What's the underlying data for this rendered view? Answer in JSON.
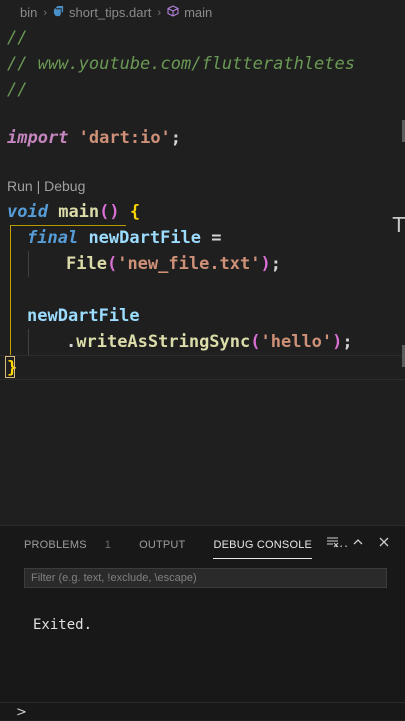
{
  "breadcrumb": {
    "folder": "bin",
    "file": "short_tips.dart",
    "symbol": "main"
  },
  "code": {
    "comment1": "//",
    "comment2": "// www.youtube.com/flutterathletes",
    "comment3": "//",
    "import_kw": "import",
    "import_str": "'dart:io'",
    "import_end": ";",
    "codelens": "Run | Debug",
    "main_type": "void",
    "main_name": "main",
    "main_parens": "()",
    "main_brace": "{",
    "final_kw": "final",
    "var_name": "newDartFile",
    "assign": "=",
    "ctor": "File",
    "ctor_open": "(",
    "ctor_arg": "'new_file.txt'",
    "ctor_close": ")",
    "ctor_end": ";",
    "var_ref": "newDartFile",
    "method_dot": ".",
    "method": "writeAsStringSync",
    "method_open": "(",
    "method_arg": "'hello'",
    "method_close": ")",
    "method_end": ";",
    "close_brace": "}"
  },
  "panel": {
    "tabs": [
      {
        "label": "PROBLEMS",
        "count": "1"
      },
      {
        "label": "OUTPUT"
      },
      {
        "label": "DEBUG CONSOLE"
      }
    ],
    "more_label": "···",
    "filter_placeholder": "Filter (e.g. text, !exclude, \\escape)",
    "output": "Exited.",
    "prompt": ">"
  },
  "colors": {
    "background": "#1f1f1f",
    "panel_background": "#181818",
    "comment": "#6a9955",
    "string": "#ce9178",
    "keyword": "#569cd6",
    "function": "#dcdcaa",
    "variable": "#9cdcfe",
    "bracket": "#ffd700"
  }
}
